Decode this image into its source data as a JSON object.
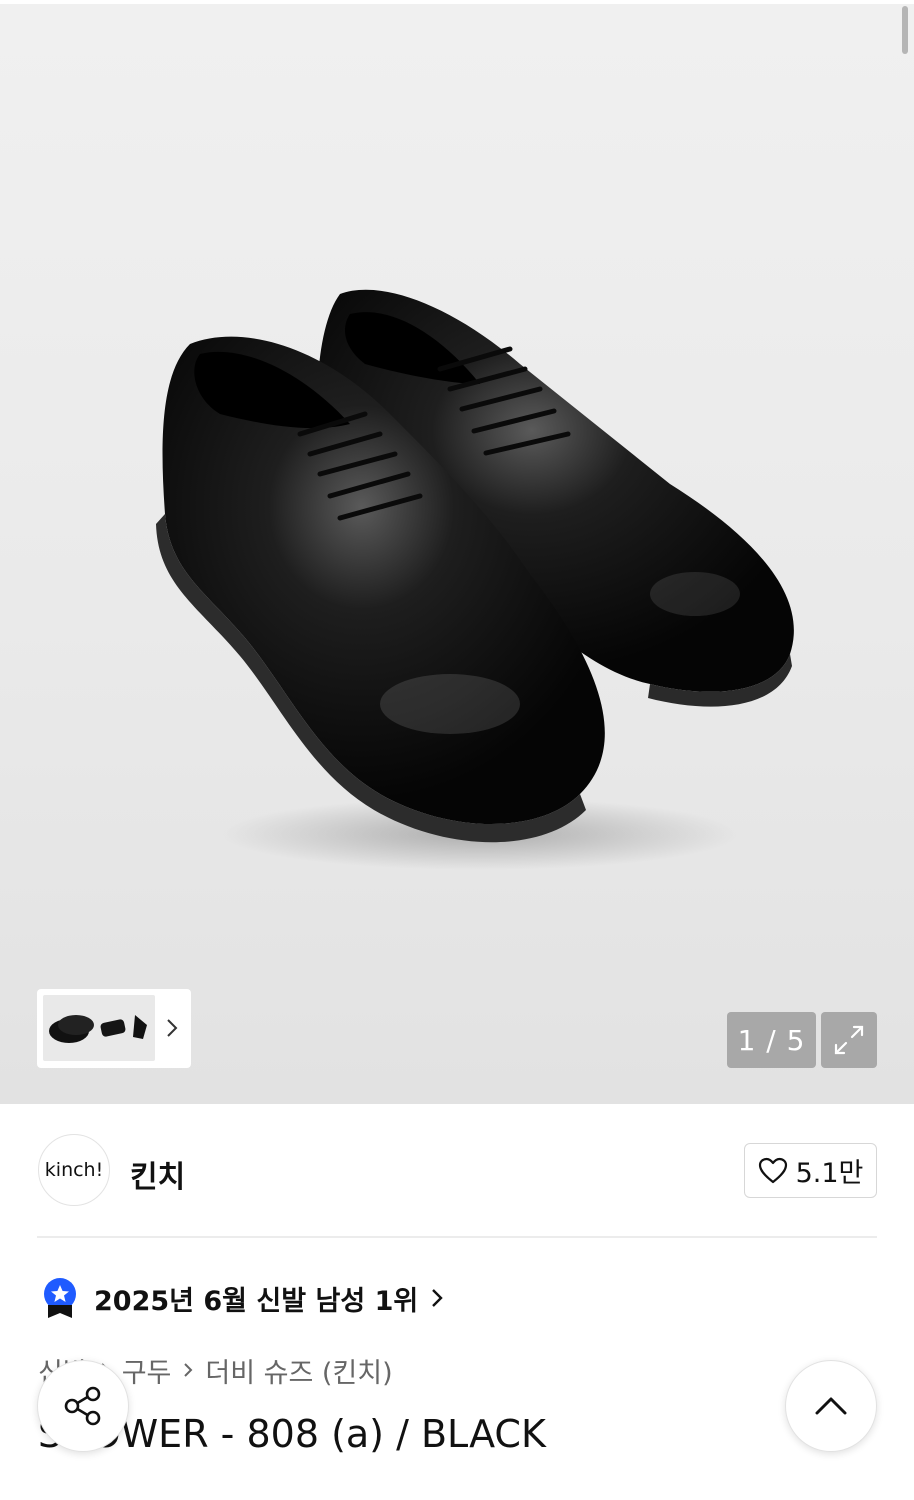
{
  "gallery": {
    "image_alt": "black derby shoes",
    "counter": "1 / 5",
    "thumbnails_icon": "shoe-thumbnails",
    "thumb_more_icon": "chevron-right-icon",
    "expand_icon": "expand-icon"
  },
  "brand": {
    "logo_text": "kinch!",
    "name": "킨치",
    "likes": "5.1만",
    "like_icon": "heart-outline-icon"
  },
  "ranking": {
    "text": "2025년 6월 신발 남성 1위",
    "badge_icon": "ranking-star-badge-icon",
    "badge_color": "#1f5bff"
  },
  "breadcrumb": {
    "items": [
      "신발",
      "구두",
      "더비 슈즈 (킨치)"
    ]
  },
  "product": {
    "title": "SHOWER - 808 (a) / BLACK"
  },
  "floating": {
    "share_icon": "share-icon",
    "scroll_top_icon": "chevron-up-icon"
  }
}
